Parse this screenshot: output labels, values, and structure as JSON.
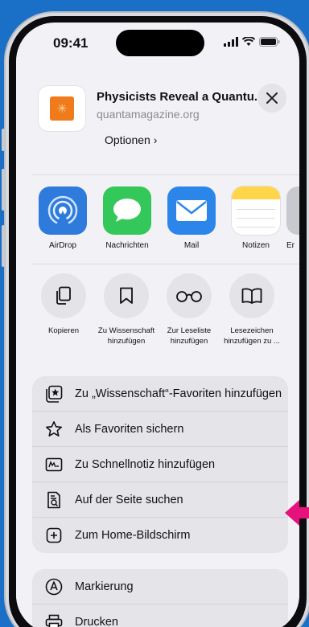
{
  "status": {
    "time": "09:41"
  },
  "share_header": {
    "title": "Physicists Reveal a Quantu...",
    "site": "quantamagazine.org",
    "options_label": "Optionen"
  },
  "apps": [
    {
      "label": "AirDrop",
      "icon": "airdrop-icon",
      "color": "#2f7bdc"
    },
    {
      "label": "Nachrichten",
      "icon": "messages-icon",
      "color": "#34c759"
    },
    {
      "label": "Mail",
      "icon": "mail-icon",
      "color": "#2c86ea"
    },
    {
      "label": "Notizen",
      "icon": "notes-icon",
      "color": "#ffd54a"
    },
    {
      "label": "Er",
      "icon": "partial-app-icon",
      "color": "#9aa0a8"
    }
  ],
  "actions": [
    {
      "label": "Kopieren",
      "icon": "copy-icon"
    },
    {
      "label": "Zu Wissenschaft hinzufügen",
      "icon": "bookmark-icon"
    },
    {
      "label": "Zur Leseliste hinzufügen",
      "icon": "glasses-icon"
    },
    {
      "label": "Lesezeichen hinzufügen zu ...",
      "icon": "book-icon"
    }
  ],
  "list_primary": [
    {
      "label": "Zu „Wissenschaft“-Favoriten hinzufügen",
      "icon": "favorites-folder-icon"
    },
    {
      "label": "Als Favoriten sichern",
      "icon": "star-icon"
    },
    {
      "label": "Zu Schnellnotiz hinzufügen",
      "icon": "quick-note-icon"
    },
    {
      "label": "Auf der Seite suchen",
      "icon": "find-on-page-icon"
    },
    {
      "label": "Zum Home-Bildschirm",
      "icon": "add-square-icon"
    }
  ],
  "list_secondary": [
    {
      "label": "Markierung",
      "icon": "markup-icon"
    },
    {
      "label": "Drucken",
      "icon": "print-icon"
    }
  ],
  "colors": {
    "background": "#1a6fc6",
    "pointer": "#e6117c"
  }
}
